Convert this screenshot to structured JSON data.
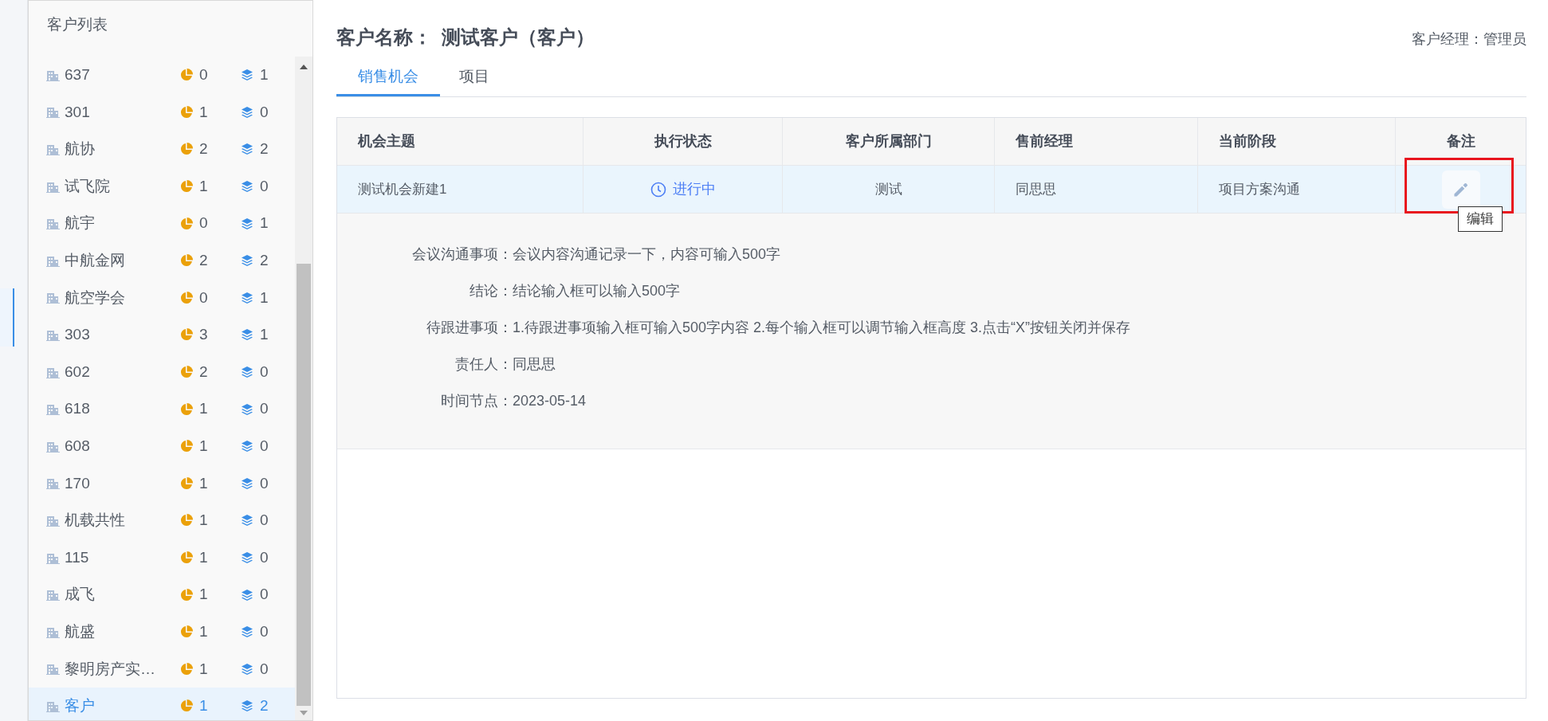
{
  "sidebar": {
    "title": "客户列表",
    "items": [
      {
        "name": "637",
        "opportunities": "0",
        "projects": "1",
        "selected": false
      },
      {
        "name": "301",
        "opportunities": "1",
        "projects": "0",
        "selected": false
      },
      {
        "name": "航协",
        "opportunities": "2",
        "projects": "2",
        "selected": false
      },
      {
        "name": "试飞院",
        "opportunities": "1",
        "projects": "0",
        "selected": false
      },
      {
        "name": "航宇",
        "opportunities": "0",
        "projects": "1",
        "selected": false
      },
      {
        "name": "中航金网",
        "opportunities": "2",
        "projects": "2",
        "selected": false
      },
      {
        "name": "航空学会",
        "opportunities": "0",
        "projects": "1",
        "selected": false
      },
      {
        "name": "303",
        "opportunities": "3",
        "projects": "1",
        "selected": false
      },
      {
        "name": "602",
        "opportunities": "2",
        "projects": "0",
        "selected": false
      },
      {
        "name": "618",
        "opportunities": "1",
        "projects": "0",
        "selected": false
      },
      {
        "name": "608",
        "opportunities": "1",
        "projects": "0",
        "selected": false
      },
      {
        "name": "170",
        "opportunities": "1",
        "projects": "0",
        "selected": false
      },
      {
        "name": "机载共性",
        "opportunities": "1",
        "projects": "0",
        "selected": false
      },
      {
        "name": "115",
        "opportunities": "1",
        "projects": "0",
        "selected": false
      },
      {
        "name": "成飞",
        "opportunities": "1",
        "projects": "0",
        "selected": false
      },
      {
        "name": "航盛",
        "opportunities": "1",
        "projects": "0",
        "selected": false
      },
      {
        "name": "黎明房产实…",
        "opportunities": "1",
        "projects": "0",
        "selected": false
      },
      {
        "name": "客户",
        "opportunities": "1",
        "projects": "2",
        "selected": true
      }
    ]
  },
  "header": {
    "customer_label": "客户名称：",
    "customer_name": "测试客户（客户）",
    "manager": "客户经理：管理员"
  },
  "tabs": [
    {
      "label": "销售机会",
      "selected": true
    },
    {
      "label": "项目",
      "selected": false
    }
  ],
  "table": {
    "columns": [
      "机会主题",
      "执行状态",
      "客户所属部门",
      "售前经理",
      "当前阶段",
      "备注"
    ],
    "rows": [
      {
        "selected": true,
        "cells": [
          {
            "kind": "text",
            "text": "测试机会新建1"
          },
          {
            "kind": "status",
            "text": "进行中"
          },
          {
            "kind": "text",
            "text": "测试"
          },
          {
            "kind": "text",
            "text": "同思思"
          },
          {
            "kind": "text",
            "text": "项目方案沟通"
          },
          {
            "kind": "edit",
            "tooltip": "编辑"
          }
        ]
      }
    ],
    "detail": [
      {
        "label": "会议沟通事项：",
        "value": "会议内容沟通记录一下，内容可输入500字"
      },
      {
        "label": "结论：",
        "value": "结论输入框可以输入500字"
      },
      {
        "label": "待跟进事项：",
        "value": "1.待跟进事项输入框可输入500字内容 2.每个输入框可以调节输入框高度 3.点击“X”按钮关闭并保存"
      },
      {
        "label": "责任人：",
        "value": "同思思"
      },
      {
        "label": "时间节点：",
        "value": "2023-05-14"
      }
    ]
  }
}
